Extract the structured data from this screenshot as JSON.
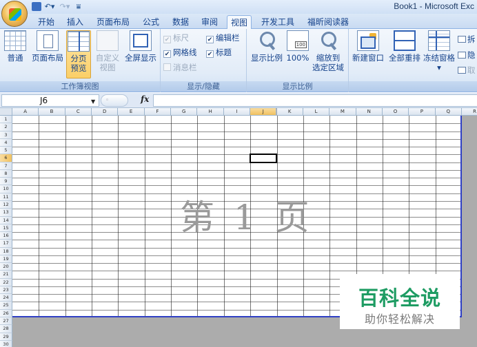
{
  "app": {
    "title": "Book1 - Microsoft Exc"
  },
  "tabs": [
    {
      "label": "开始",
      "active": false
    },
    {
      "label": "插入",
      "active": false
    },
    {
      "label": "页面布局",
      "active": false
    },
    {
      "label": "公式",
      "active": false
    },
    {
      "label": "数据",
      "active": false
    },
    {
      "label": "审阅",
      "active": false
    },
    {
      "label": "视图",
      "active": true
    },
    {
      "label": "开发工具",
      "active": false
    },
    {
      "label": "福昕阅读器",
      "active": false
    }
  ],
  "ribbon": {
    "workbook_views": {
      "label": "工作簿视图",
      "normal": "普通",
      "page_layout": "页面布局",
      "page_break_1": "分页",
      "page_break_2": "预览",
      "custom_1": "自定义",
      "custom_2": "视图",
      "full_screen": "全屏显示"
    },
    "show_hide": {
      "label": "显示/隐藏",
      "ruler": {
        "label": "标尺",
        "checked": true,
        "enabled": false
      },
      "formula_bar": {
        "label": "编辑栏",
        "checked": true,
        "enabled": true
      },
      "gridlines": {
        "label": "网格线",
        "checked": true,
        "enabled": true
      },
      "headings": {
        "label": "标题",
        "checked": true,
        "enabled": true
      },
      "message_bar": {
        "label": "消息栏",
        "checked": false,
        "enabled": false
      }
    },
    "zoom": {
      "label": "显示比例",
      "zoom": "显示比例",
      "hundred": "100%",
      "selection_1": "缩放到",
      "selection_2": "选定区域"
    },
    "window": {
      "new_window": "新建窗口",
      "arrange_all": "全部重排",
      "freeze_panes": "冻结窗格",
      "freeze_arrow": "▾",
      "split": "拆",
      "hide": "隐",
      "unhide": "取"
    }
  },
  "formula_bar": {
    "name_box": "J6",
    "fx": "fx",
    "formula": ""
  },
  "sheet": {
    "columns": [
      "A",
      "B",
      "C",
      "D",
      "E",
      "F",
      "G",
      "H",
      "I",
      "J",
      "K",
      "L",
      "M",
      "N",
      "O",
      "P",
      "Q",
      "R"
    ],
    "rows": [
      "1",
      "2",
      "3",
      "4",
      "5",
      "6",
      "7",
      "8",
      "9",
      "10",
      "11",
      "12",
      "13",
      "14",
      "15",
      "16",
      "17",
      "18",
      "19",
      "20",
      "21",
      "22",
      "23",
      "24",
      "25",
      "26",
      "27",
      "28",
      "29",
      "30"
    ],
    "active_cell": "J6",
    "page_label": "第 1 页",
    "print_area_rows": 26,
    "print_area_cols": 17
  },
  "watermark": {
    "title": "百科全说",
    "subtitle": "助你轻松解决"
  },
  "colors": {
    "accent": "#15428b",
    "page_break": "#2f3fc5",
    "badge_green": "#1e9c63",
    "selected_header": "#f1c15f"
  }
}
